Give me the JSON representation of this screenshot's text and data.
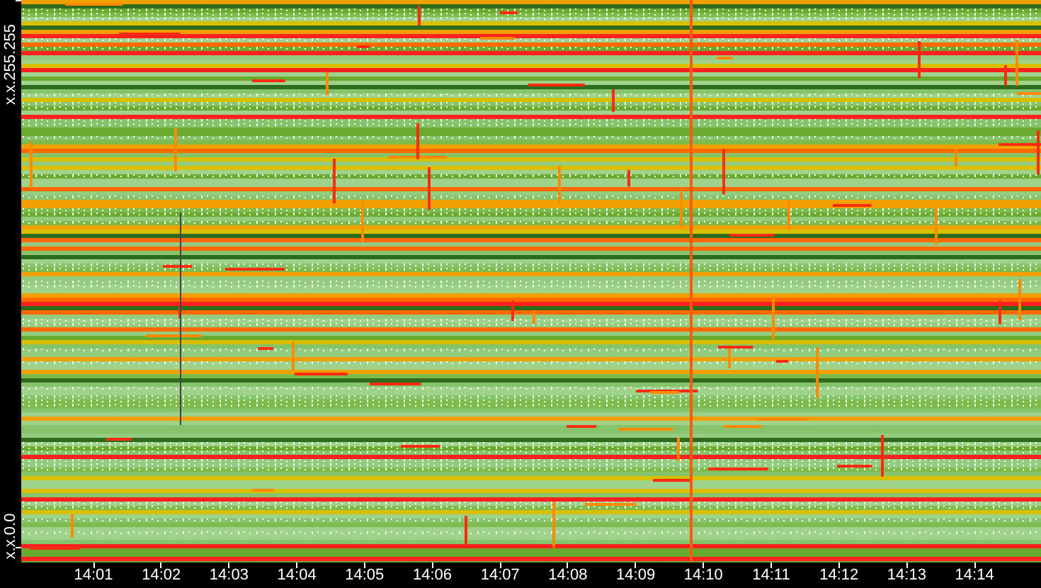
{
  "y_axis": {
    "top_label": "x.x.255.255",
    "bottom_label": "x.x.0.0"
  },
  "x_axis": {
    "ticks": [
      "14:01",
      "14:02",
      "14:03",
      "14:04",
      "14:05",
      "14:06",
      "14:07",
      "14:08",
      "14:09",
      "14:10",
      "14:11",
      "14:12",
      "14:13",
      "14:14"
    ]
  }
}
